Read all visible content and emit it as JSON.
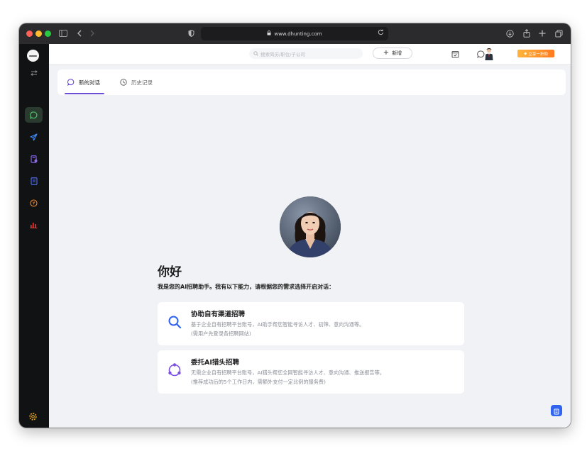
{
  "browser": {
    "url": "www.dhunting.com"
  },
  "topbar": {
    "search_placeholder": "搜索简历/职位/子公司",
    "new_button": "新增",
    "vip_badge": "立享一折购"
  },
  "tabs": [
    {
      "label": "新的对话",
      "active": true
    },
    {
      "label": "历史记录",
      "active": false
    }
  ],
  "main": {
    "greeting": "你好",
    "intro": "我是您的AI招聘助手。我有以下能力，请根据您的需求选择开启对话：",
    "options": [
      {
        "title": "协助自有渠道招聘",
        "desc": "基于企业自有招聘平台账号，AI助手帮您智能寻访人才、初筛、意向沟通等。\n(需用户先登录各招聘网站)",
        "icon": "search-icon"
      },
      {
        "title": "委托AI猎头招聘",
        "desc": "无需企业自有招聘平台账号，AI猎头帮您全网智能寻访人才、意向沟通、推送报告等。\n(推荐成功后的5个工作日内，需额外支付一定比例的服务费)",
        "icon": "network-icon"
      }
    ]
  },
  "colors": {
    "accent": "#6d4ed8",
    "sidebar_bg": "#111214",
    "vip_orange": "#ff8a24",
    "fab_blue": "#2f63f0"
  }
}
